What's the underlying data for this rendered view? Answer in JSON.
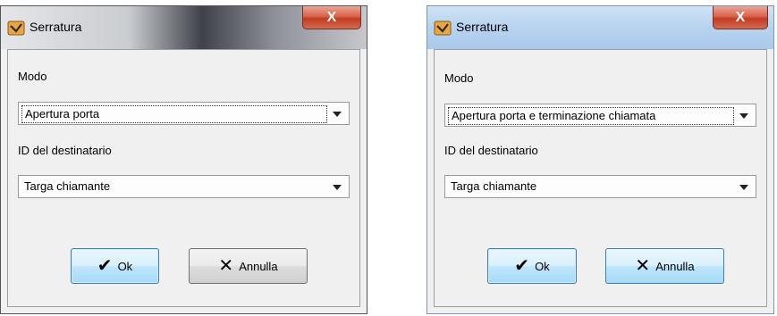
{
  "dialogs": [
    {
      "title": "Serratura",
      "close_label": "X",
      "mode_label": "Modo",
      "mode_value": "Apertura porta",
      "recipient_label": "ID del destinatario",
      "recipient_value": "Targa chiamante",
      "ok_label": "Ok",
      "cancel_label": "Annulla"
    },
    {
      "title": "Serratura",
      "close_label": "X",
      "mode_label": "Modo",
      "mode_value": "Apertura porta e terminazione chiamata",
      "recipient_label": "ID del destinatario",
      "recipient_value": "Targa chiamante",
      "ok_label": "Ok",
      "cancel_label": "Annulla"
    }
  ],
  "icons": {
    "app": "lock-app-icon",
    "close": "close-icon",
    "ok": "checkmark-icon",
    "cancel": "x-icon",
    "dropdown": "chevron-down-icon"
  }
}
